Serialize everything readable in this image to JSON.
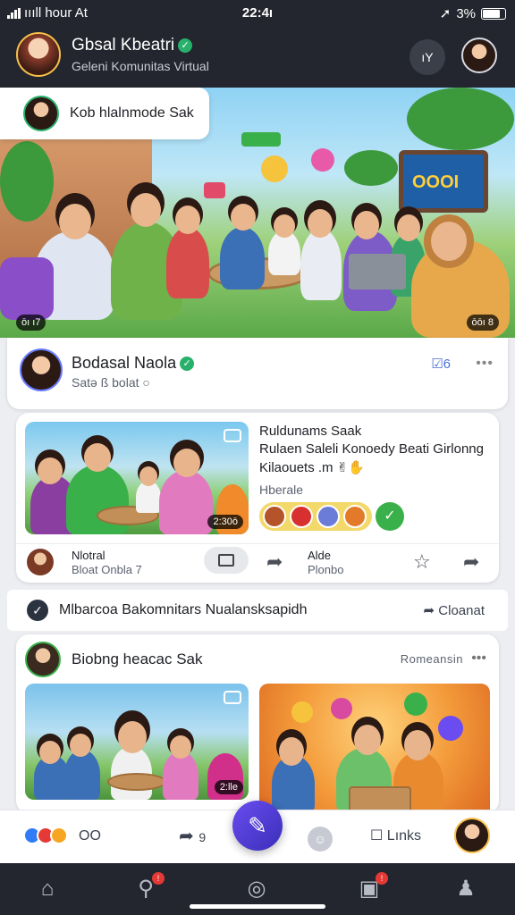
{
  "status_bar": {
    "carrier": "ıııll hour At",
    "time": "22:4ı",
    "battery": "3%"
  },
  "header": {
    "title": "Gbsal Kbeatri",
    "subtitle": "Geleni Komunitas Virtual",
    "action_label": "ıY"
  },
  "hero": {
    "caption": "Kob hlalnmode Sak",
    "screen_text": "OOOI",
    "badge_left": "ōı ı7",
    "badge_right": "ōōı 8"
  },
  "post_header": {
    "name": "Bodasal Naola",
    "meta": "Satə ß bolat ○",
    "action": "☑6"
  },
  "featured": {
    "line1": "Ruldunams Saak",
    "line2": "Rulaen Saleli Konoedy Beati Girlonng",
    "line3": "Kilaouets .m ✌✋",
    "label": "Hberale",
    "duration": "2:30ō",
    "author_name": "Nlotral",
    "author_meta": "Bloat Onbla 7",
    "mid_name": "Alde",
    "mid_meta": "Plonbo"
  },
  "banner": {
    "text": "Mlbarcoa Bakomnitars Nualansksapidh",
    "action": "Cloanat"
  },
  "post2": {
    "title": "Biobng heacac Sak",
    "right": "Romeansin",
    "duration": "2:lle"
  },
  "actionrow": {
    "count": "ОО",
    "share_count": "9",
    "messages": "Lınks"
  },
  "nav": {
    "items": [
      "home",
      "search",
      "compass",
      "inbox",
      "profile"
    ],
    "badges": {
      "search": "!",
      "inbox": "!"
    }
  },
  "colors": {
    "accent": "#4a3fd0",
    "verified": "#27b16a",
    "bar": "#23262e"
  }
}
